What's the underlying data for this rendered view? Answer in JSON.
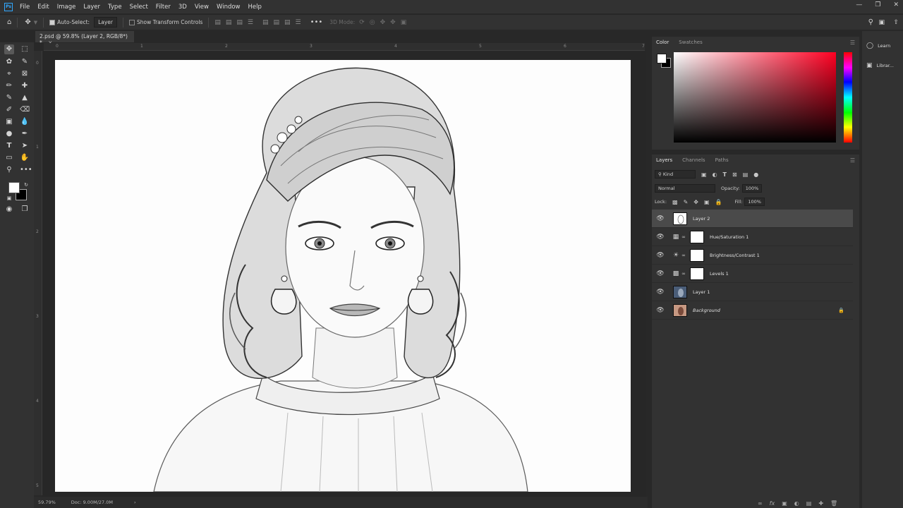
{
  "app": {
    "logo": "Ps"
  },
  "menu": [
    "File",
    "Edit",
    "Image",
    "Layer",
    "Type",
    "Select",
    "Filter",
    "3D",
    "View",
    "Window",
    "Help"
  ],
  "options": {
    "auto_select_label": "Auto-Select:",
    "auto_select_value": "Layer",
    "show_transform_label": "Show Transform Controls",
    "mode_3d_label": "3D Mode:"
  },
  "document": {
    "tab_title": "2.psd @ 59.8% (Layer 2, RGB/8*) *",
    "zoom": "59.79%",
    "doc_info": "Doc: 9.00M/27.0M"
  },
  "rulers": {
    "top": [
      "0",
      "1",
      "2",
      "3",
      "4",
      "5",
      "6",
      "7"
    ],
    "left": [
      "0",
      "1",
      "2",
      "3",
      "4",
      "5"
    ]
  },
  "color_panel": {
    "tabs": [
      "Color",
      "Swatches"
    ],
    "active_tab": "Color",
    "foreground": "#ffffff",
    "background": "#000000",
    "hue_base": "#ff0022"
  },
  "layers_panel": {
    "tabs": [
      "Layers",
      "Channels",
      "Paths"
    ],
    "active_tab": "Layers",
    "filter_kind": "Kind",
    "blend_mode": "Normal",
    "opacity_label": "Opacity:",
    "opacity_value": "100%",
    "lock_label": "Lock:",
    "fill_label": "Fill:",
    "fill_value": "100%",
    "layers": [
      {
        "name": "Layer 2",
        "type": "pixel",
        "selected": true,
        "visible": true
      },
      {
        "name": "Hue/Saturation 1",
        "type": "adjustment",
        "adj_icon": "hue-saturation-icon",
        "visible": true
      },
      {
        "name": "Brightness/Contrast 1",
        "type": "adjustment",
        "adj_icon": "brightness-contrast-icon",
        "visible": true
      },
      {
        "name": "Levels 1",
        "type": "adjustment",
        "adj_icon": "levels-icon",
        "visible": true
      },
      {
        "name": "Layer 1",
        "type": "pixel",
        "visible": true
      },
      {
        "name": "Background",
        "type": "background",
        "locked": true,
        "visible": true
      }
    ]
  },
  "right_rail": {
    "learn": "Learn",
    "libraries": "Librar..."
  }
}
